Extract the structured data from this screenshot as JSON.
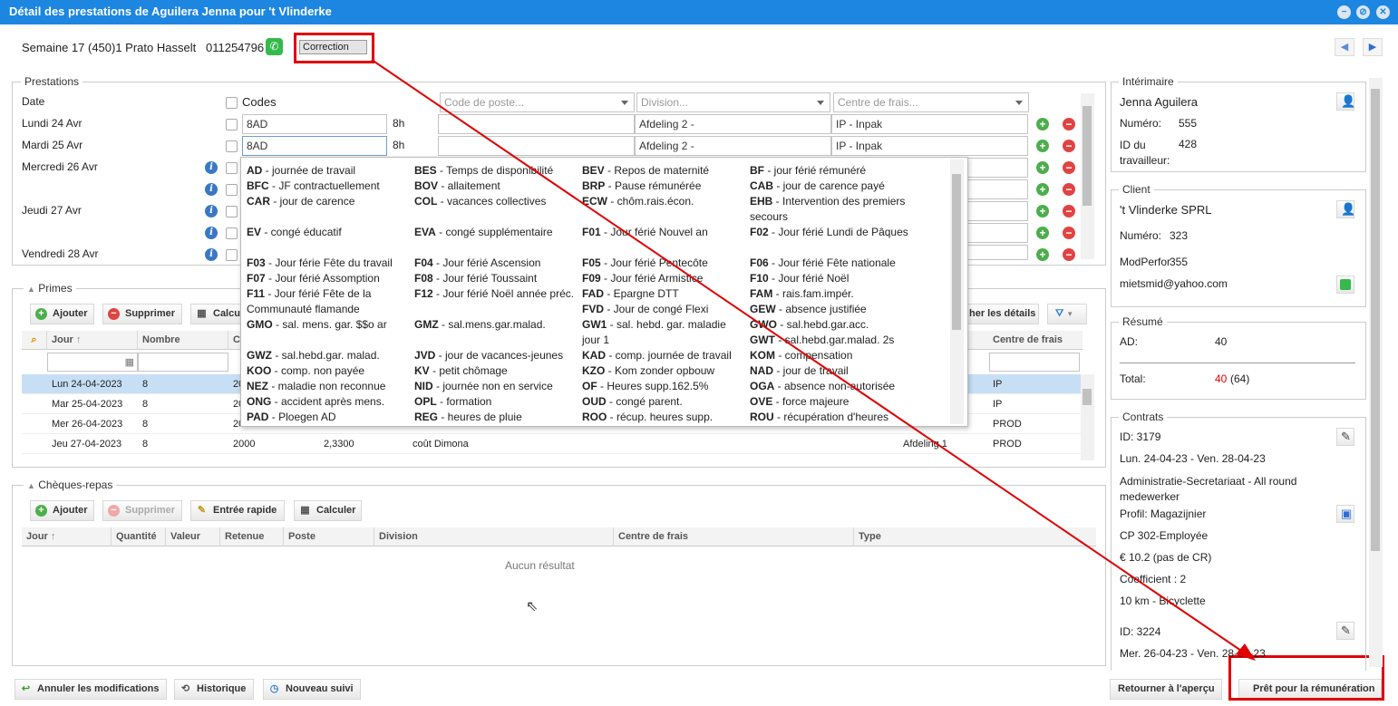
{
  "title": "Détail des prestations de Aguilera Jenna pour 't Vlinderke",
  "header": {
    "week_info": "Semaine 17 (450)1 Prato Hasselt",
    "phone": "011254796",
    "status": "Correction"
  },
  "prestations": {
    "legend": "Prestations",
    "col_date": "Date",
    "col_codes": "Codes",
    "poste_placeholder": "Code de poste...",
    "division_placeholder": "Division...",
    "centre_placeholder": "Centre de frais...",
    "rows": [
      {
        "date": "Lundi 24 Avr",
        "code": "8AD",
        "hours": "8h",
        "division": "Afdeling 2 -",
        "centre": "IP - Inpak"
      },
      {
        "date": "Mardi 25 Avr",
        "code": "8AD",
        "hours": "8h",
        "division": "Afdeling 2 -",
        "centre": "IP - Inpak"
      },
      {
        "date": "Mercredi 26 Avr"
      },
      {
        "date": ""
      },
      {
        "date": "Jeudi 27 Avr"
      },
      {
        "date": ""
      },
      {
        "date": "Vendredi 28 Avr"
      }
    ]
  },
  "codes_popup": [
    [
      {
        "c": "AD",
        "d": "journée de travail"
      },
      {
        "c": "BES",
        "d": "Temps de disponibilité"
      },
      {
        "c": "BEV",
        "d": "Repos de maternité"
      },
      {
        "c": "BF",
        "d": "jour férié rémunéré"
      }
    ],
    [
      {
        "c": "BFC",
        "d": "JF contractuellement"
      },
      {
        "c": "BOV",
        "d": "allaitement"
      },
      {
        "c": "BRP",
        "d": "Pause rémunérée"
      },
      {
        "c": "CAB",
        "d": "jour de carence payé"
      }
    ],
    [
      {
        "c": "CAR",
        "d": "jour de carence"
      },
      {
        "c": "COL",
        "d": "vacances collectives"
      },
      {
        "c": "ECW",
        "d": "chôm.rais.écon."
      },
      {
        "c": "EHB",
        "d": "Intervention des premiers secours"
      }
    ],
    [
      {
        "c": "EV",
        "d": "congé éducatif"
      },
      {
        "c": "EVA",
        "d": "congé supplémentaire"
      },
      {
        "c": "F01",
        "d": "Jour férié Nouvel an"
      },
      {
        "c": "F02",
        "d": "Jour férié Lundi de Pâques"
      }
    ],
    [
      {
        "c": "F03",
        "d": "Jour férie Fête du travail"
      },
      {
        "c": "F04",
        "d": "Jour férié Ascension"
      },
      {
        "c": "F05",
        "d": "Jour férié Pentecôte"
      },
      {
        "c": "F06",
        "d": "Jour férié Fête nationale"
      }
    ],
    [
      {
        "c": "F07",
        "d": "Jour férié Assomption"
      },
      {
        "c": "F08",
        "d": "Jour férié Toussaint"
      },
      {
        "c": "F09",
        "d": "Jour férié Armistice"
      },
      {
        "c": "F10",
        "d": "Jour férié Noël"
      }
    ],
    [
      {
        "c": "F11",
        "d": "Jour férié Fête de la Communauté flamande"
      },
      {
        "c": "F12",
        "d": "Jour férié Noël année préc."
      },
      {
        "c": "FAD",
        "d": "Epargne DTT"
      },
      {
        "c": "FAM",
        "d": "rais.fam.impér."
      }
    ],
    [
      {
        "c": "",
        "d": ""
      },
      {
        "c": "",
        "d": ""
      },
      {
        "c": "FVD",
        "d": "Jour de congé Flexi"
      },
      {
        "c": "GEW",
        "d": "absence justifiée"
      }
    ],
    [
      {
        "c": "GMO",
        "d": "sal. mens. gar. $$o ar"
      },
      {
        "c": "GMZ",
        "d": "sal.mens.gar.malad."
      },
      {
        "c": "GW1",
        "d": "sal. hebd. gar. maladie jour 1"
      },
      {
        "c": "GWO",
        "d": "sal.hebd.gar.acc."
      }
    ],
    [
      {
        "c": "",
        "d": ""
      },
      {
        "c": "",
        "d": ""
      },
      {
        "c": "",
        "d": ""
      },
      {
        "c": "GWT",
        "d": "sal.hebd.gar.malad. 2s"
      }
    ],
    [
      {
        "c": "GWZ",
        "d": "sal.hebd.gar. malad."
      },
      {
        "c": "JVD",
        "d": "jour de vacances-jeunes"
      },
      {
        "c": "KAD",
        "d": "comp. journée de travail"
      },
      {
        "c": "KOM",
        "d": "compensation"
      }
    ],
    [
      {
        "c": "KOO",
        "d": "comp. non payée"
      },
      {
        "c": "KV",
        "d": "petit chômage"
      },
      {
        "c": "KZO",
        "d": "Kom zonder opbouw"
      },
      {
        "c": "NAD",
        "d": "jour de travail"
      }
    ],
    [
      {
        "c": "NEZ",
        "d": "maladie non reconnue"
      },
      {
        "c": "NID",
        "d": "journée non en service"
      },
      {
        "c": "OF",
        "d": "Heures supp.162.5%"
      },
      {
        "c": "OGA",
        "d": "absence non-autorisée"
      }
    ],
    [
      {
        "c": "ONG",
        "d": "accident après mens."
      },
      {
        "c": "OPL",
        "d": "formation"
      },
      {
        "c": "OUD",
        "d": "congé parent."
      },
      {
        "c": "OVE",
        "d": "force majeure"
      }
    ],
    [
      {
        "c": "PAD",
        "d": "Ploegen AD"
      },
      {
        "c": "REG",
        "d": "heures de pluie"
      },
      {
        "c": "ROO",
        "d": "récup. heures supp."
      },
      {
        "c": "ROU",
        "d": "récupération d'heures"
      }
    ]
  ],
  "primes": {
    "legend": "Primes",
    "add": "Ajouter",
    "delete": "Supprimer",
    "calc": "Calcu",
    "details": "her les détails",
    "columns": [
      "Jour",
      "Nombre",
      "C",
      "Centre de frais"
    ],
    "rows": [
      {
        "jour": "Lun 24-04-2023",
        "nombre": "8",
        "c": "20",
        "c2": "",
        "desc": "",
        "div": "",
        "centre": "IP"
      },
      {
        "jour": "Mar 25-04-2023",
        "nombre": "8",
        "c": "20",
        "c2": "",
        "desc": "",
        "div": "",
        "centre": "IP"
      },
      {
        "jour": "Mer 26-04-2023",
        "nombre": "8",
        "c": "20",
        "c2": "",
        "desc": "",
        "div": "",
        "centre": "PROD"
      },
      {
        "jour": "Jeu 27-04-2023",
        "nombre": "8",
        "c": "2000",
        "c2": "2,3300",
        "desc": "coût Dimona",
        "div": "Afdeling 1",
        "centre": "PROD"
      }
    ]
  },
  "cheques": {
    "legend": "Chèques-repas",
    "add": "Ajouter",
    "delete": "Supprimer",
    "quick": "Entrée rapide",
    "calc": "Calculer",
    "columns": [
      "Jour",
      "Quantité",
      "Valeur",
      "Retenue",
      "Poste",
      "Division",
      "Centre de frais",
      "Type"
    ],
    "empty": "Aucun résultat"
  },
  "footer": {
    "cancel": "Annuler les modifications",
    "history": "Historique",
    "new_follow": "Nouveau suivi",
    "back": "Retourner à l'aperçu",
    "ready": "Prêt pour la rémunération"
  },
  "interimaire": {
    "legend": "Intérimaire",
    "name": "Jenna Aguilera",
    "num_label": "Numéro:",
    "num": "555",
    "id_label": "ID du travailleur:",
    "id": "428"
  },
  "client": {
    "legend": "Client",
    "name": "'t Vlinderke SPRL",
    "num_label": "Numéro:",
    "num": "323",
    "modperf_label": "ModPerfor",
    "modperf": "355",
    "email": "mietsmid@yahoo.com"
  },
  "resume": {
    "legend": "Résumé",
    "ad_label": "AD:",
    "ad": "40",
    "total_label": "Total:",
    "total": "40",
    "total_extra": "(64)"
  },
  "contrats": {
    "legend": "Contrats",
    "c1_id": "ID: 3179",
    "c1_dates": "Lun. 24-04-23 - Ven. 28-04-23",
    "c1_func": "Administratie-Secretariaat - All round medewerker",
    "c1_profil": "Profil: Magazijnier",
    "c1_cp": "CP 302-Employée",
    "c1_rate": "€ 10.2 (pas de CR)",
    "c1_coef": "Coefficient : 2",
    "c1_km": "10 km - Bicyclette",
    "c2_id": "ID: 3224",
    "c2_dates": "Mer. 26-04-23 - Ven. 28-04-23"
  },
  "colors": {
    "title_bar": "#1c86e1",
    "annotation": "#e00000",
    "selected_row": "#c7dff5",
    "total_red": "#e00000"
  }
}
